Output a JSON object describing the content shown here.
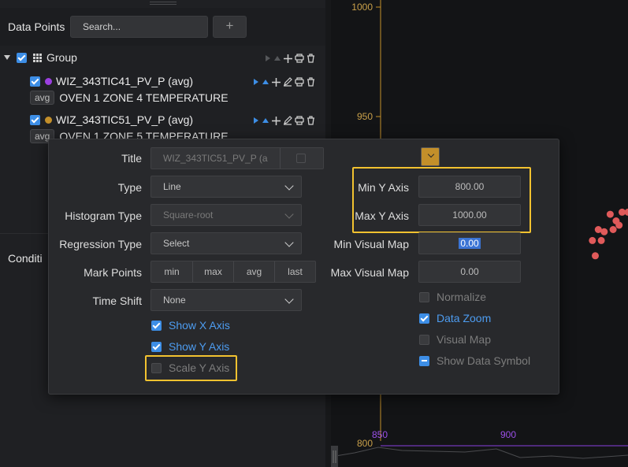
{
  "data_points": {
    "title": "Data Points",
    "search_placeholder": "Search...",
    "add_label": "+"
  },
  "tree": {
    "group_label": "Group",
    "series": [
      {
        "name": "WIZ_343TIC41_PV_P (avg)",
        "tag": "avg",
        "description": "OVEN 1 ZONE 4 TEMPERATURE",
        "color": "#9b3fe0"
      },
      {
        "name": "WIZ_343TIC51_PV_P (avg)",
        "tag": "avg",
        "description": "OVEN 1 ZONE 5 TEMPERATURE",
        "color": "#c38f2a"
      }
    ]
  },
  "conditions_label": "Conditi",
  "dialog": {
    "title_label": "Title",
    "title_value": "WIZ_343TIC51_PV_P (a",
    "type_label": "Type",
    "type_value": "Line",
    "histogram_label": "Histogram Type",
    "histogram_value": "Square-root",
    "regression_label": "Regression Type",
    "regression_value": "Select",
    "mark_points_label": "Mark Points",
    "mark_points": [
      "min",
      "max",
      "avg",
      "last"
    ],
    "time_shift_label": "Time Shift",
    "time_shift_value": "None",
    "show_x_axis": {
      "label": "Show X Axis",
      "checked": true
    },
    "show_y_axis": {
      "label": "Show Y Axis",
      "checked": true
    },
    "scale_y_axis": {
      "label": "Scale Y Axis",
      "checked": false
    },
    "min_y_label": "Min Y Axis",
    "min_y_value": "800.00",
    "max_y_label": "Max Y Axis",
    "max_y_value": "1000.00",
    "min_visual_label": "Min Visual Map",
    "min_visual_value": "0.00",
    "max_visual_label": "Max Visual Map",
    "max_visual_value": "0.00",
    "normalize": {
      "label": "Normalize",
      "checked": false
    },
    "data_zoom": {
      "label": "Data Zoom",
      "checked": true
    },
    "visual_map": {
      "label": "Visual Map",
      "checked": false
    },
    "show_data_symbol": {
      "label": "Show Data Symbol",
      "checked": "partial"
    },
    "series_color": "#c38f2a"
  },
  "chart_data": {
    "type": "scatter",
    "y_ticks": [
      "1000",
      "950",
      "800"
    ],
    "x_ticks": [
      "850",
      "900"
    ],
    "ylim": [
      800,
      1000
    ],
    "series": [
      {
        "color": "#e05a5a",
        "points": [
          [
            0.94,
            905
          ],
          [
            0.98,
            906
          ],
          [
            1.0,
            906
          ],
          [
            0.92,
            897
          ],
          [
            0.95,
            898
          ],
          [
            0.96,
            902
          ],
          [
            0.97,
            900
          ],
          [
            0.9,
            898
          ],
          [
            0.88,
            893
          ],
          [
            0.91,
            893
          ],
          [
            0.89,
            886
          ]
        ]
      }
    ],
    "accent_colors": {
      "y_axis": "#c38f2a",
      "x_axis": "#8a3fe0"
    }
  }
}
